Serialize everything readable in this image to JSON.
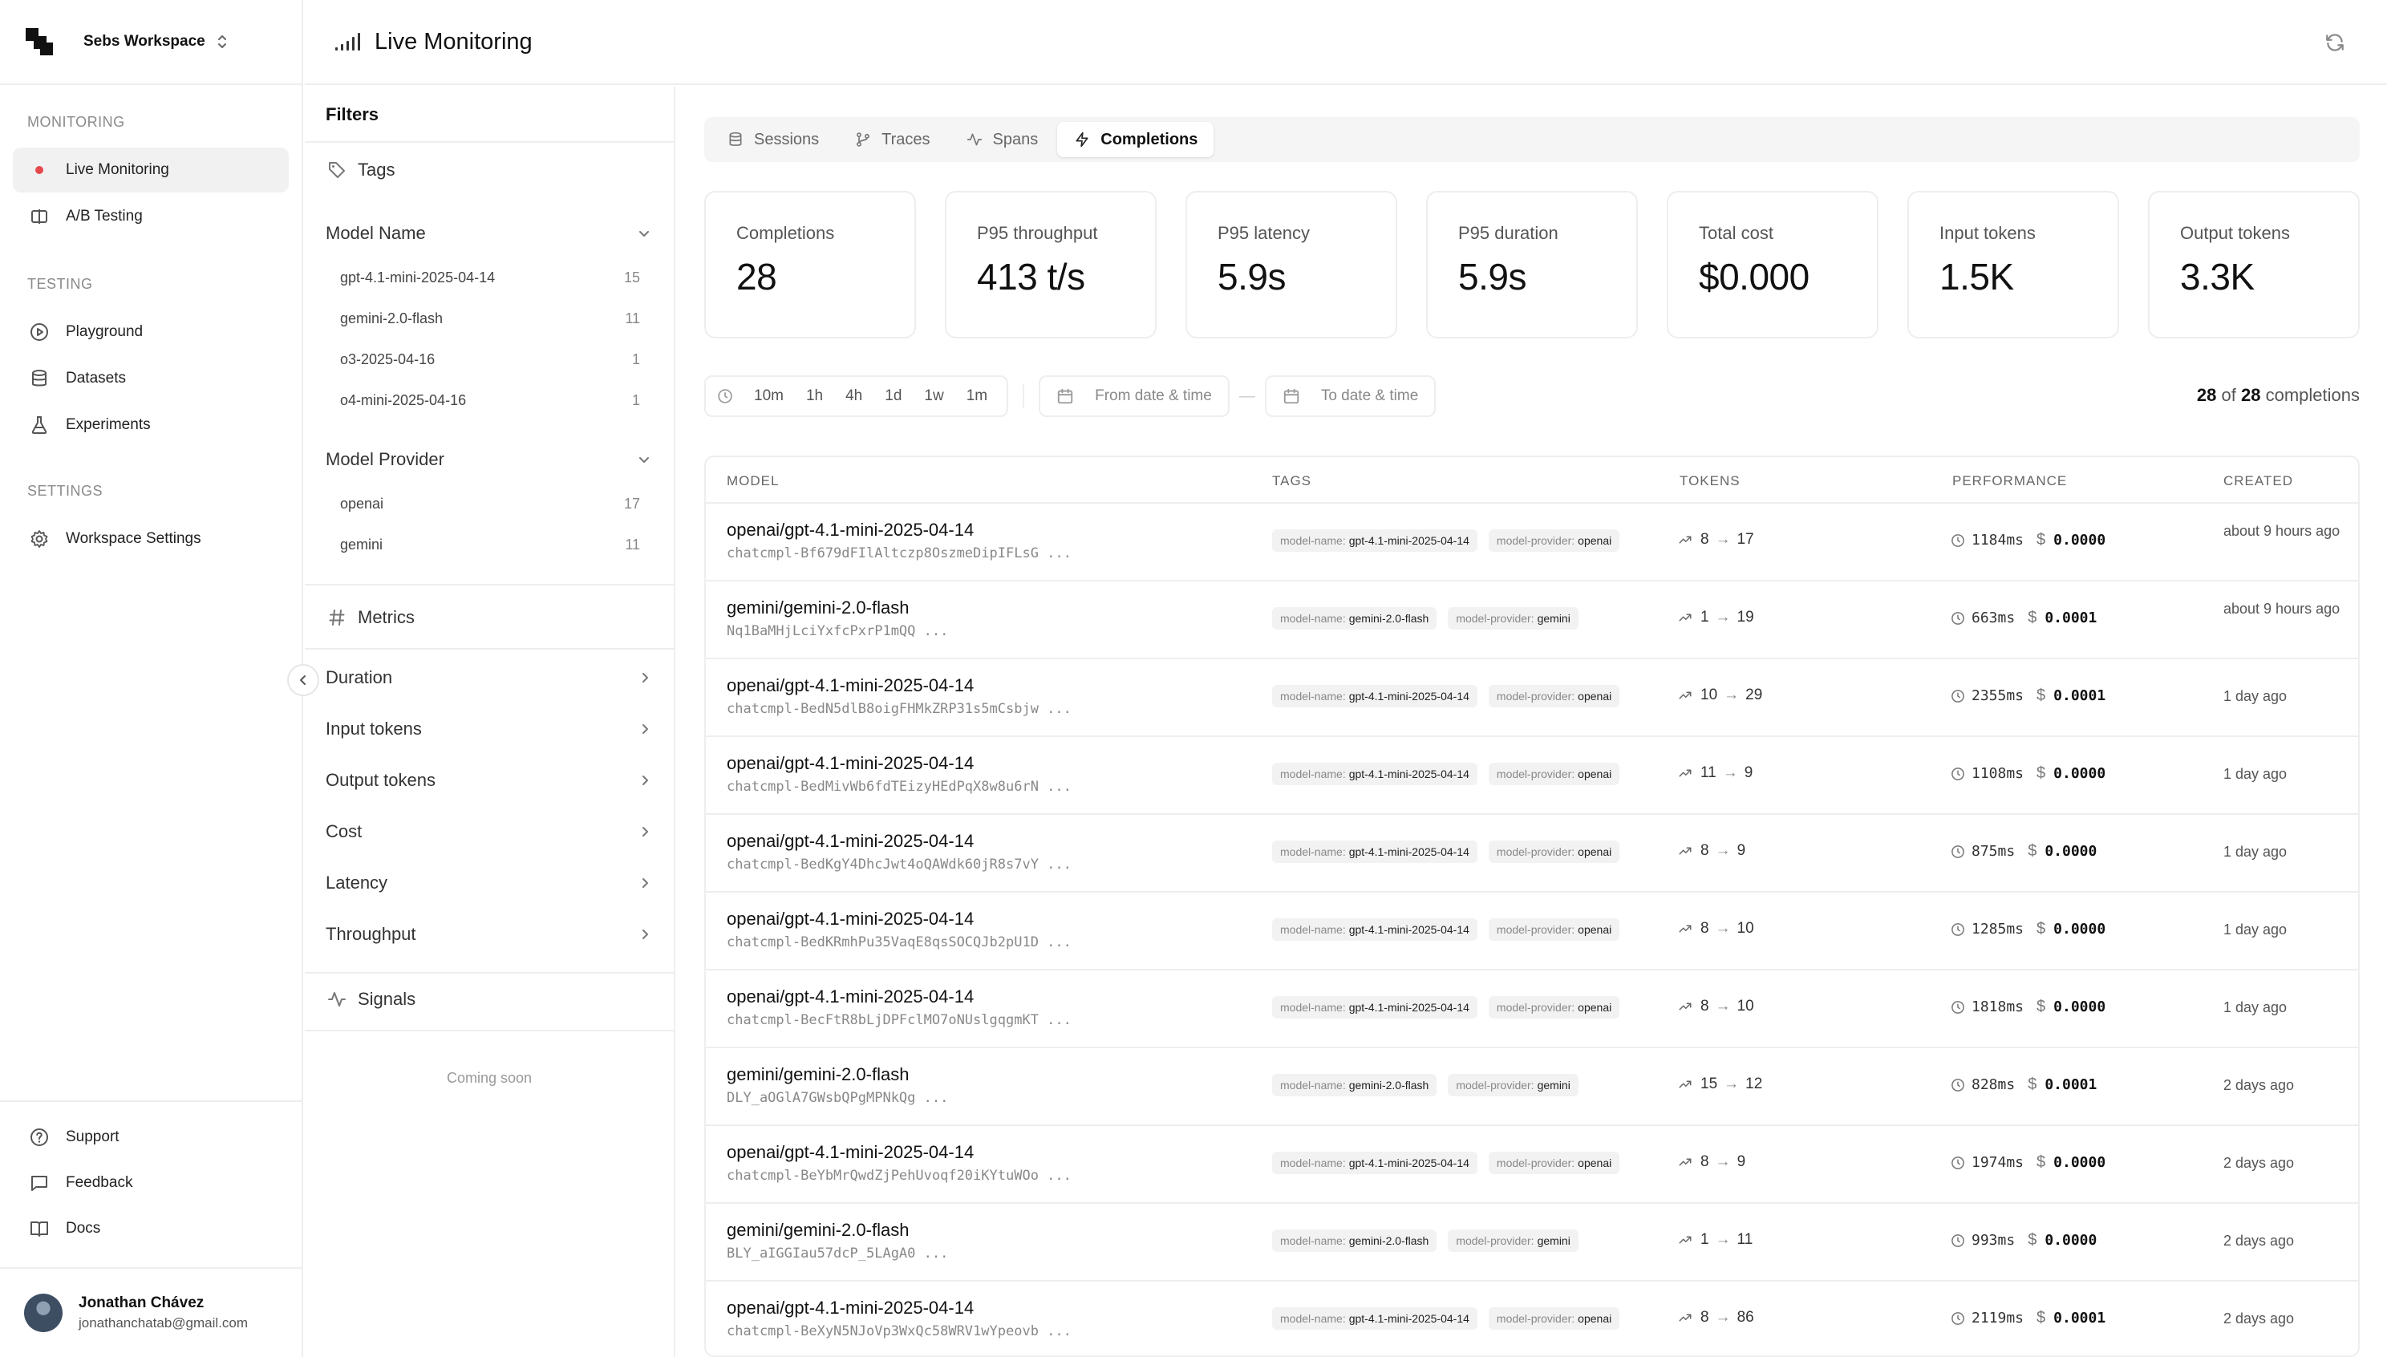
{
  "workspace": {
    "name": "Sebs Workspace"
  },
  "sidebar": {
    "sections": {
      "monitoring": "MONITORING",
      "testing": "TESTING",
      "settings": "SETTINGS"
    },
    "items": {
      "live_monitoring": "Live Monitoring",
      "ab_testing": "A/B Testing",
      "playground": "Playground",
      "datasets": "Datasets",
      "experiments": "Experiments",
      "workspace_settings": "Workspace Settings",
      "support": "Support",
      "feedback": "Feedback",
      "docs": "Docs"
    },
    "user": {
      "name": "Jonathan Chávez",
      "email": "jonathanchatab@gmail.com"
    }
  },
  "header": {
    "title": "Live Monitoring"
  },
  "filters": {
    "title": "Filters",
    "tags_label": "Tags",
    "model_name": {
      "label": "Model Name",
      "items": [
        {
          "name": "gpt-4.1-mini-2025-04-14",
          "count": "15"
        },
        {
          "name": "gemini-2.0-flash",
          "count": "11"
        },
        {
          "name": "o3-2025-04-16",
          "count": "1"
        },
        {
          "name": "o4-mini-2025-04-16",
          "count": "1"
        }
      ]
    },
    "model_provider": {
      "label": "Model Provider",
      "items": [
        {
          "name": "openai",
          "count": "17"
        },
        {
          "name": "gemini",
          "count": "11"
        }
      ]
    },
    "metrics_label": "Metrics",
    "metrics": [
      "Duration",
      "Input tokens",
      "Output tokens",
      "Cost",
      "Latency",
      "Throughput"
    ],
    "signals_label": "Signals",
    "coming_soon": "Coming soon"
  },
  "tabs": [
    "Sessions",
    "Traces",
    "Spans",
    "Completions"
  ],
  "active_tab": "Completions",
  "stats": [
    {
      "label": "Completions",
      "value": "28"
    },
    {
      "label": "P95 throughput",
      "value": "413 t/s"
    },
    {
      "label": "P95 latency",
      "value": "5.9s"
    },
    {
      "label": "P95 duration",
      "value": "5.9s"
    },
    {
      "label": "Total cost",
      "value": "$0.000"
    },
    {
      "label": "Input tokens",
      "value": "1.5K"
    },
    {
      "label": "Output tokens",
      "value": "3.3K"
    }
  ],
  "time_range": {
    "options": [
      "10m",
      "1h",
      "4h",
      "1d",
      "1w",
      "1m"
    ],
    "from_placeholder": "From date & time",
    "to_placeholder": "To date & time",
    "separator": "—"
  },
  "count": {
    "shown": "28",
    "of_label": "of",
    "total": "28",
    "suffix": "completions"
  },
  "table": {
    "columns": [
      "MODEL",
      "TAGS",
      "TOKENS",
      "PERFORMANCE",
      "CREATED"
    ],
    "tag_keys": {
      "model_name": "model-name:",
      "model_provider": "model-provider:"
    },
    "rows": [
      {
        "model": "openai/gpt-4.1-mini-2025-04-14",
        "id": "chatcmpl-Bf679dFIlAltczp8OszmeDipIFLsG ...",
        "tag_model": "gpt-4.1-mini-2025-04-14",
        "tag_provider": "openai",
        "tokens_in": "8",
        "tokens_out": "17",
        "duration": "1184ms",
        "cost": "0.0000",
        "created": "about 9 hours ago"
      },
      {
        "model": "gemini/gemini-2.0-flash",
        "id": "Nq1BaMHjLciYxfcPxrP1mQQ ...",
        "tag_model": "gemini-2.0-flash",
        "tag_provider": "gemini",
        "tokens_in": "1",
        "tokens_out": "19",
        "duration": "663ms",
        "cost": "0.0001",
        "created": "about 9 hours ago"
      },
      {
        "model": "openai/gpt-4.1-mini-2025-04-14",
        "id": "chatcmpl-BedN5dlB8oigFHMkZRP31s5mCsbjw ...",
        "tag_model": "gpt-4.1-mini-2025-04-14",
        "tag_provider": "openai",
        "tokens_in": "10",
        "tokens_out": "29",
        "duration": "2355ms",
        "cost": "0.0001",
        "created": "1 day ago"
      },
      {
        "model": "openai/gpt-4.1-mini-2025-04-14",
        "id": "chatcmpl-BedMivWb6fdTEizyHEdPqX8w8u6rN ...",
        "tag_model": "gpt-4.1-mini-2025-04-14",
        "tag_provider": "openai",
        "tokens_in": "11",
        "tokens_out": "9",
        "duration": "1108ms",
        "cost": "0.0000",
        "created": "1 day ago"
      },
      {
        "model": "openai/gpt-4.1-mini-2025-04-14",
        "id": "chatcmpl-BedKgY4DhcJwt4oQAWdk60jR8s7vY ...",
        "tag_model": "gpt-4.1-mini-2025-04-14",
        "tag_provider": "openai",
        "tokens_in": "8",
        "tokens_out": "9",
        "duration": "875ms",
        "cost": "0.0000",
        "created": "1 day ago"
      },
      {
        "model": "openai/gpt-4.1-mini-2025-04-14",
        "id": "chatcmpl-BedKRmhPu35VaqE8qsSOCQJb2pU1D ...",
        "tag_model": "gpt-4.1-mini-2025-04-14",
        "tag_provider": "openai",
        "tokens_in": "8",
        "tokens_out": "10",
        "duration": "1285ms",
        "cost": "0.0000",
        "created": "1 day ago"
      },
      {
        "model": "openai/gpt-4.1-mini-2025-04-14",
        "id": "chatcmpl-BecFtR8bLjDPFclMO7oNUslgqgmKT ...",
        "tag_model": "gpt-4.1-mini-2025-04-14",
        "tag_provider": "openai",
        "tokens_in": "8",
        "tokens_out": "10",
        "duration": "1818ms",
        "cost": "0.0000",
        "created": "1 day ago"
      },
      {
        "model": "gemini/gemini-2.0-flash",
        "id": "DLY_aOGlA7GWsbQPgMPNkQg ...",
        "tag_model": "gemini-2.0-flash",
        "tag_provider": "gemini",
        "tokens_in": "15",
        "tokens_out": "12",
        "duration": "828ms",
        "cost": "0.0001",
        "created": "2 days ago"
      },
      {
        "model": "openai/gpt-4.1-mini-2025-04-14",
        "id": "chatcmpl-BeYbMrQwdZjPehUvoqf20iKYtuWOo ...",
        "tag_model": "gpt-4.1-mini-2025-04-14",
        "tag_provider": "openai",
        "tokens_in": "8",
        "tokens_out": "9",
        "duration": "1974ms",
        "cost": "0.0000",
        "created": "2 days ago"
      },
      {
        "model": "gemini/gemini-2.0-flash",
        "id": "BLY_aIGGIau57dcP_5LAgA0 ...",
        "tag_model": "gemini-2.0-flash",
        "tag_provider": "gemini",
        "tokens_in": "1",
        "tokens_out": "11",
        "duration": "993ms",
        "cost": "0.0000",
        "created": "2 days ago"
      },
      {
        "model": "openai/gpt-4.1-mini-2025-04-14",
        "id": "chatcmpl-BeXyN5NJoVp3WxQc58WRV1wYpeovb ...",
        "tag_model": "gpt-4.1-mini-2025-04-14",
        "tag_provider": "openai",
        "tokens_in": "8",
        "tokens_out": "86",
        "duration": "2119ms",
        "cost": "0.0001",
        "created": "2 days ago"
      }
    ]
  }
}
